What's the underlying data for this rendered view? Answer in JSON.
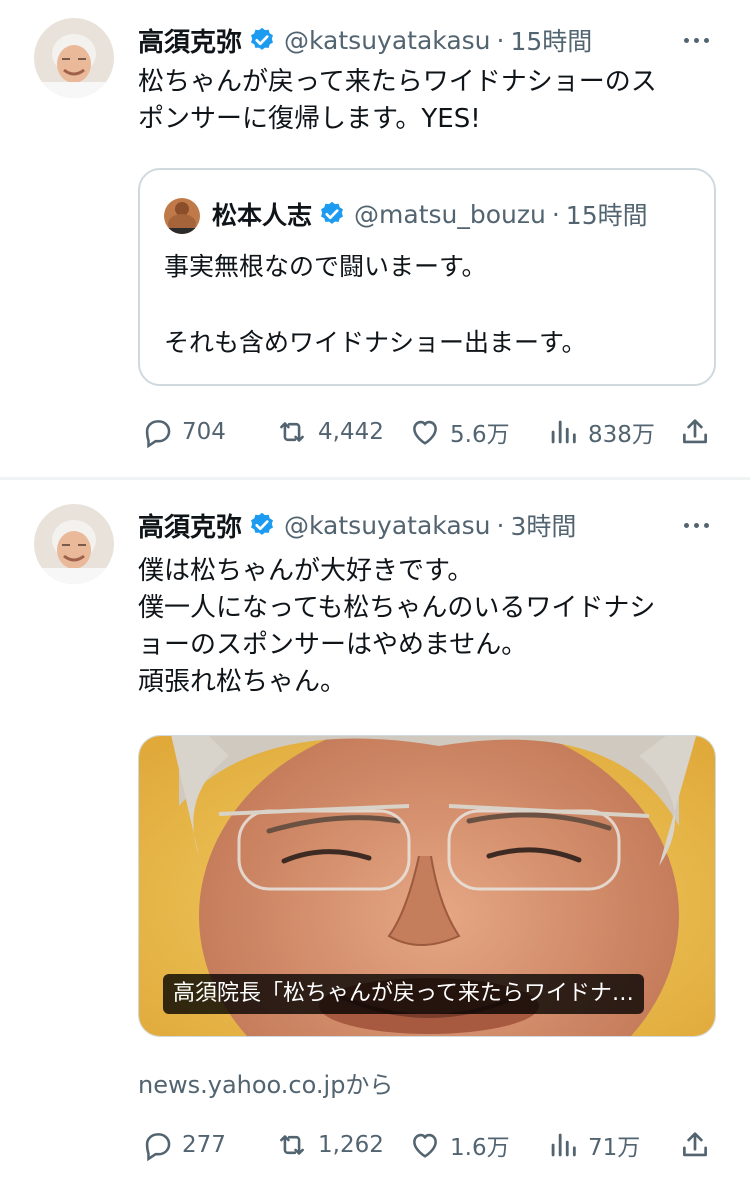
{
  "tweets": [
    {
      "author": {
        "name": "高須克弥",
        "handle": "@katsuyatakasu",
        "time": "15時間",
        "verified": true
      },
      "text_lines": [
        "松ちゃんが戻って来たらワイドナショーのス",
        "ポンサーに復帰します。YES!"
      ],
      "quote": {
        "author": {
          "name": "松本人志",
          "handle": "@matsu_bouzu",
          "time": "15時間",
          "verified": true
        },
        "text_lines": [
          "事実無根なので闘いまーす。",
          "",
          "それも含めワイドナショー出まーす。"
        ]
      },
      "metrics": {
        "replies": "704",
        "retweets": "4,442",
        "likes": "5.6万",
        "views": "838万"
      }
    },
    {
      "author": {
        "name": "高須克弥",
        "handle": "@katsuyatakasu",
        "time": "3時間",
        "verified": true
      },
      "text_lines": [
        "僕は松ちゃんが大好きです。",
        "僕一人になっても松ちゃんのいるワイドナシ",
        "ョーのスポンサーはやめません。",
        "頑張れ松ちゃん。"
      ],
      "link_card": {
        "caption": "高須院長「松ちゃんが戻って来たらワイドナ…",
        "source": "news.yahoo.co.jpから"
      },
      "metrics": {
        "replies": "277",
        "retweets": "1,262",
        "likes": "1.6万",
        "views": "71万"
      }
    }
  ],
  "icons": {
    "reply": "reply-icon",
    "retweet": "retweet-icon",
    "like": "like-icon",
    "views": "views-icon",
    "share": "share-icon",
    "verified": "verified-badge-icon",
    "more": "more-icon"
  },
  "colors": {
    "verified": "#1d9bf0",
    "secondary_text": "#536471",
    "border": "#cfd9de"
  }
}
